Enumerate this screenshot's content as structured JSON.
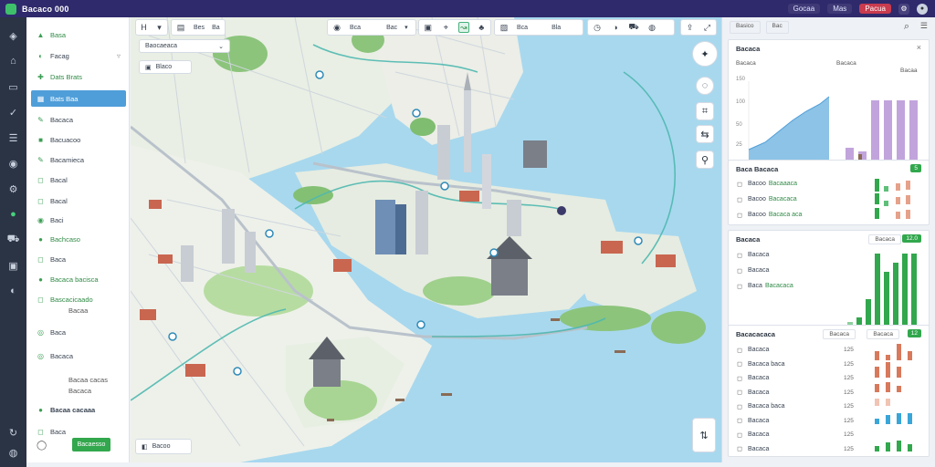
{
  "app": {
    "title": "Bacaco 000"
  },
  "titlebar": {
    "btn1": "Gocaa",
    "btn2": "Mas",
    "btn3": "Pacua",
    "gear": "⚙",
    "avatar": "●"
  },
  "rail_icons": [
    "layers-icon",
    "home-icon",
    "folder-icon",
    "check-icon",
    "list-icon",
    "map-pin-icon",
    "settings-icon",
    "chart-icon",
    "car-icon",
    "bus-icon",
    "tag-icon",
    "refresh-icon",
    "user-icon"
  ],
  "sidebar": {
    "items": [
      {
        "label": "Basa",
        "icon": "▲",
        "style": "green"
      },
      {
        "label": "Facag",
        "icon": "◐",
        "chev": "▿"
      },
      {
        "label": "Dats Brats",
        "icon": "✚",
        "style": "green"
      },
      {
        "label": "Bats Baa",
        "icon": "▦",
        "style": "active"
      },
      {
        "label": "Bacaca",
        "icon": "✎"
      },
      {
        "label": "Bacuacoo",
        "icon": "■"
      },
      {
        "label": "Bacamieca",
        "icon": "✎"
      },
      {
        "label": "Bacal",
        "icon": "◻"
      },
      {
        "label": "Bacal",
        "icon": "◻"
      },
      {
        "label": "Baci",
        "icon": "◉"
      },
      {
        "label": "Bachcaso",
        "icon": "●",
        "style": "green"
      },
      {
        "label": "Baca",
        "icon": "◻"
      },
      {
        "label": "Bacaca bacisca",
        "icon": "●",
        "style": "green"
      },
      {
        "label": "Bascacicaado",
        "icon": "◻",
        "style": "green"
      },
      {
        "label": "Bacaa",
        "icon": "",
        "style": "sub"
      },
      {
        "label": "Baca",
        "icon": "◎"
      },
      {
        "label": "Bacaca",
        "icon": "◎"
      },
      {
        "label": "Bacaa cacas",
        "icon": "",
        "style": "sub"
      },
      {
        "label": "Bacaca",
        "icon": "",
        "style": "sub"
      },
      {
        "label": "Bacaa cacaaa",
        "icon": "●",
        "style": "bold"
      },
      {
        "label": "Baca",
        "icon": "◻"
      }
    ],
    "action_label": "Bacaesso"
  },
  "map": {
    "toolbar_left": {
      "a": "H",
      "b": "Bes",
      "c": "Ba"
    },
    "search_value": "Baocaeaca",
    "chip_label": "Blaco",
    "toolbar_mid": {
      "a": "Bca",
      "b": "Bac"
    },
    "toolbar_right": {
      "a": "Bca",
      "b": "Bla"
    },
    "bottom_label": "Bacoo",
    "controls": [
      "compass-icon",
      "locate-icon",
      "grid-icon",
      "route-icon",
      "pin-icon",
      "zoom-icon"
    ]
  },
  "rightpanel": {
    "header": {
      "tab1": "Basico",
      "tab2": "Bac"
    },
    "card1": {
      "title": "Bacaca",
      "legend_left": "Bacaca",
      "legend_right": "Bacaca",
      "legend_right2": "Bacaa",
      "yticks": [
        "150",
        "100",
        "50",
        "25"
      ]
    },
    "card2": {
      "title": "Baca Bacaca",
      "badge": "5",
      "rows": [
        {
          "label": "Bacoo",
          "accent": "Bacaaaca"
        },
        {
          "label": "Bacoo",
          "accent": "Bacacaca"
        },
        {
          "label": "Bacoo",
          "accent": "Bacaca aca"
        }
      ]
    },
    "card3": {
      "title": "Bacaca",
      "chip": "Bacaca",
      "badge": "12.0",
      "rows": [
        {
          "label": "Bacaca",
          "accent": ""
        },
        {
          "label": "Bacaca",
          "accent": ""
        },
        {
          "label": "Baca",
          "accent": "Bacacaca"
        }
      ]
    },
    "card4": {
      "title": "Bacacacaca",
      "chip1": "Bacaca",
      "chip2": "Bacaca",
      "badge": "12",
      "rows": [
        {
          "label": "Bacaca",
          "num": "125"
        },
        {
          "label": "Bacaca baca",
          "num": "125"
        },
        {
          "label": "Bacaca",
          "num": "125"
        },
        {
          "label": "Bacaca",
          "num": "125"
        },
        {
          "label": "Bacaca baca",
          "num": "125"
        },
        {
          "label": "Bacaca",
          "num": "125"
        },
        {
          "label": "Bacaca",
          "num": "125"
        },
        {
          "label": "Bacaca",
          "num": "125"
        }
      ]
    }
  },
  "colors": {
    "accent": "#32a74d",
    "active": "#4f9ed9",
    "title_bar": "#2f2a6b",
    "water": "#a8d8ee"
  }
}
